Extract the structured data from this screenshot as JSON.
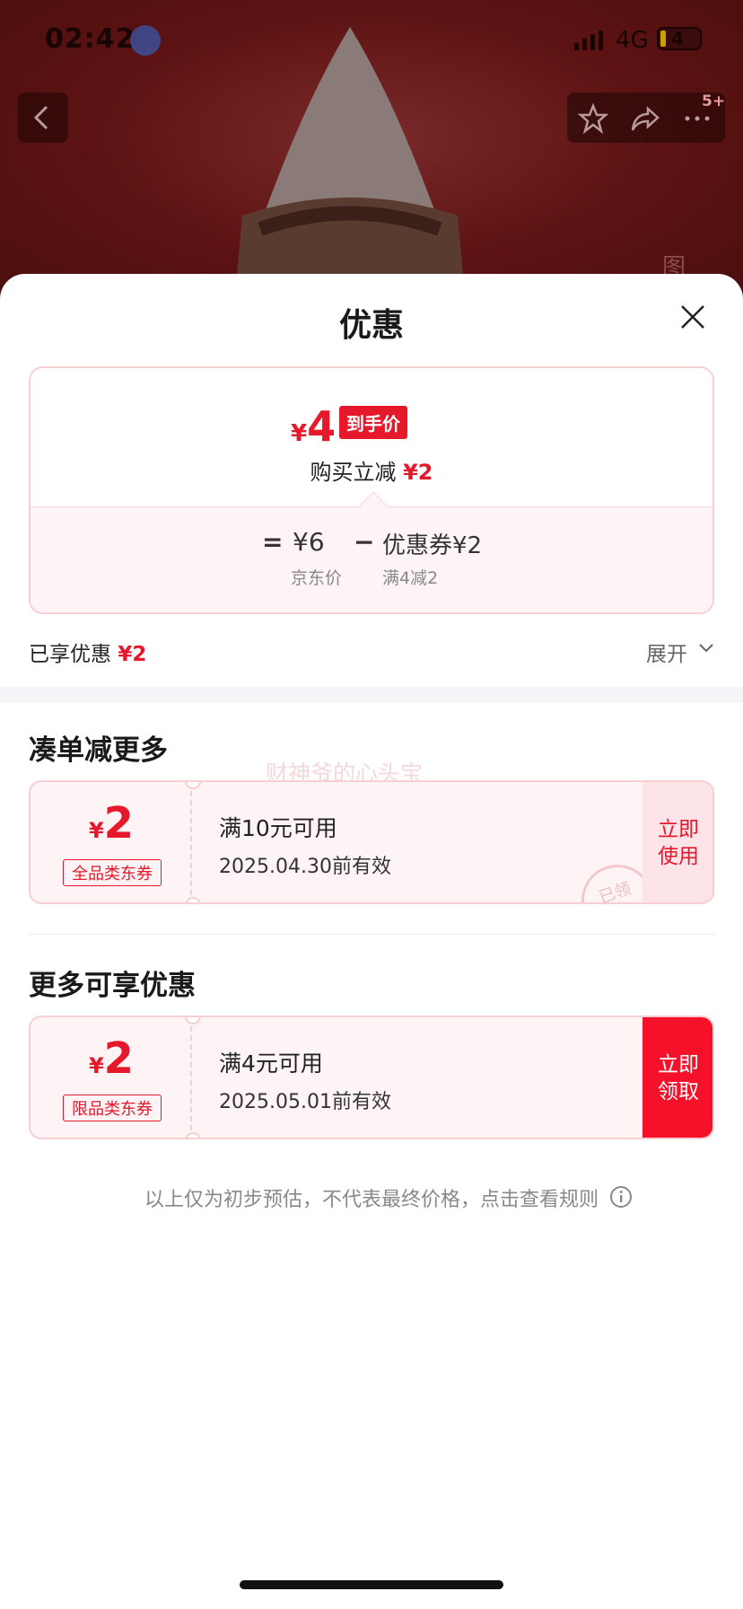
{
  "status_bar": {
    "time": "02:42",
    "network": "4G",
    "battery": "4"
  },
  "nav": {
    "badge": "5+",
    "side_text": "图"
  },
  "sheet": {
    "title": "优惠",
    "price_card": {
      "currency": "¥",
      "final_price": "4",
      "final_tag": "到手价",
      "instant_label": "购买立减",
      "instant_amount": "¥2",
      "eq": "=",
      "jd_price": "¥6",
      "jd_caption": "京东价",
      "minus": "−",
      "coupon_amount": "优惠券¥2",
      "coupon_caption": "满4减2"
    },
    "enjoyed_label": "已享优惠",
    "enjoyed_amount": "¥2",
    "expand_label": "展开",
    "section1_title": "凑单减更多",
    "watermark": "财神爷的心头宝",
    "coupon1": {
      "currency": "¥",
      "amount": "2",
      "tag": "全品类东券",
      "condition": "满10元可用",
      "validity": "2025.04.30前有效",
      "button": "立即\n使用",
      "stamp": "已领"
    },
    "section2_title": "更多可享优惠",
    "coupon2": {
      "currency": "¥",
      "amount": "2",
      "tag": "限品类东券",
      "condition": "满4元可用",
      "validity": "2025.05.01前有效",
      "button": "立即\n领取"
    },
    "disclaimer": "以上仅为初步预估，不代表最终价格，点击查看规则"
  },
  "colors": {
    "accent": "#e6182b",
    "get_button": "#f5112a"
  }
}
